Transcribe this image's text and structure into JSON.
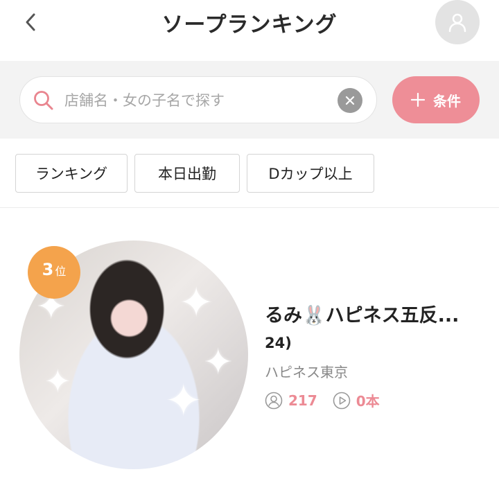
{
  "header": {
    "title": "ソープランキング",
    "back_icon": "chevron-left-icon",
    "avatar_icon": "user-icon"
  },
  "search": {
    "placeholder": "店舗名・女の子名で探す",
    "value": "",
    "search_icon": "search-icon",
    "clear_icon": "close-icon",
    "condition_button": {
      "icon": "plus-icon",
      "label": "条件"
    }
  },
  "filters": [
    {
      "label": "ランキング"
    },
    {
      "label": "本日出勤"
    },
    {
      "label": "Dカップ以上"
    }
  ],
  "card": {
    "rank_number": "3",
    "rank_suffix": "位",
    "name": "るみ🐰ハピネス五反...",
    "age": "24)",
    "shop": "ハピネス東京",
    "followers_icon": "user-circle-icon",
    "followers": "217",
    "videos_icon": "play-circle-icon",
    "videos": "0本"
  },
  "colors": {
    "accent": "#ee8e97",
    "rank_badge": "#f4a34c",
    "stat_value": "#ec8a94",
    "search_bg": "#f3f3f3"
  }
}
